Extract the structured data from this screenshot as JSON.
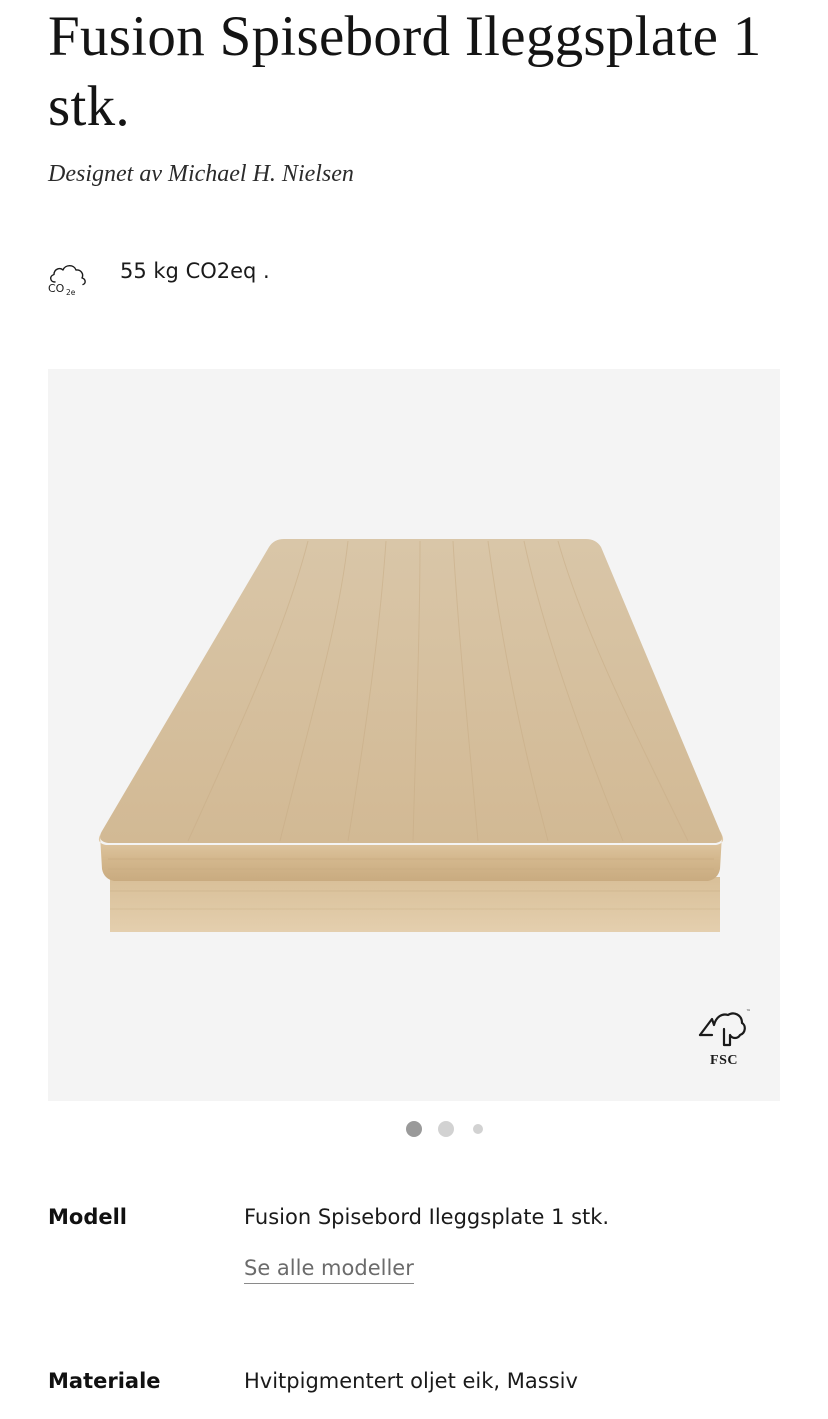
{
  "product": {
    "title": "Fusion Spisebord Ileggsplate 1 stk.",
    "designer": "Designet av Michael H. Nielsen"
  },
  "co2": {
    "icon": "co2e-cloud-icon",
    "value": "55 kg CO2eq ."
  },
  "gallery": {
    "certification_badge": "FSC",
    "wood_color": "#d9c4a4",
    "background_color": "#f4f4f4",
    "pagination": {
      "total": 3,
      "active_index": 0
    }
  },
  "specs": {
    "model": {
      "label": "Modell",
      "value": "Fusion Spisebord Ileggsplate 1 stk.",
      "link": "Se alle modeller"
    },
    "material": {
      "label": "Materiale",
      "value": "Hvitpigmentert oljet eik, Massiv"
    }
  }
}
